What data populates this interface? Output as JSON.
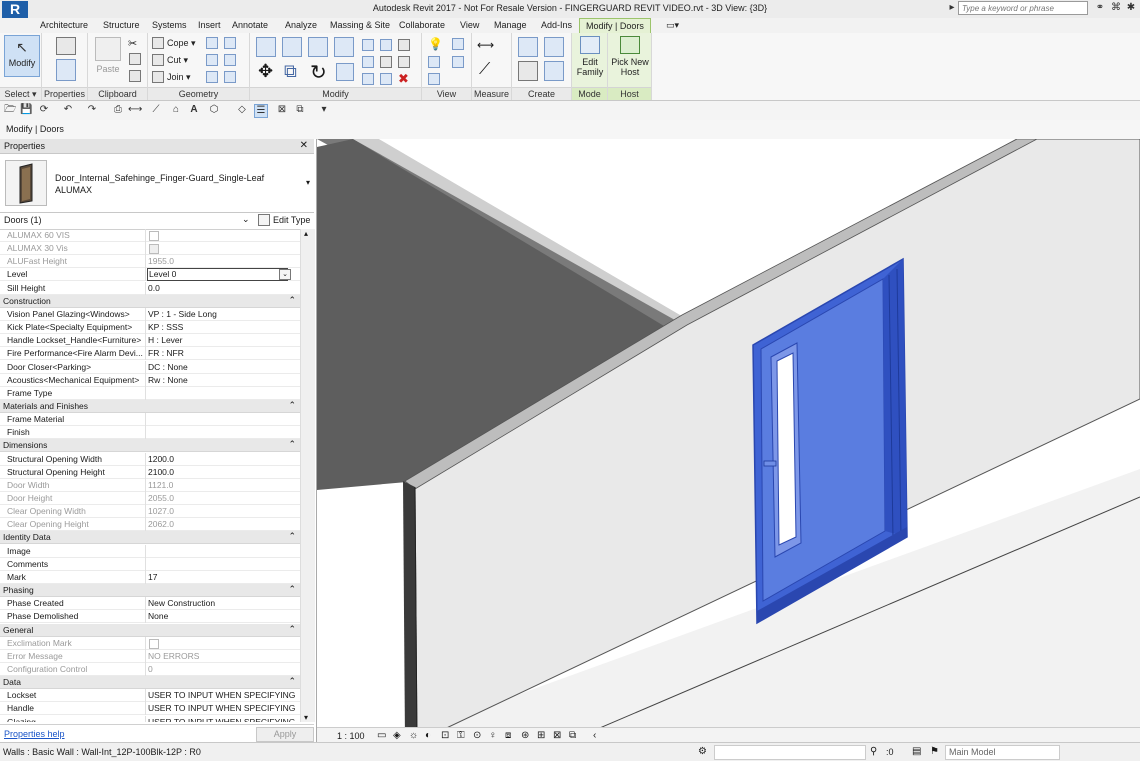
{
  "titlebar": {
    "app_letter": "R",
    "title": "Autodesk Revit 2017 -  Not For Resale Version -    FINGERGUARD REVIT VIDEO.rvt - 3D View: {3D}",
    "search_placeholder": "Type a keyword or phrase"
  },
  "tabs": [
    "Architecture",
    "Structure",
    "Systems",
    "Insert",
    "Annotate",
    "Analyze",
    "Massing & Site",
    "Collaborate",
    "View",
    "Manage",
    "Add-Ins",
    "Modify | Doors"
  ],
  "ribbon": {
    "modify_label": "Modify",
    "select_label": "Select",
    "properties_label": "Properties",
    "clipboard_label": "Clipboard",
    "paste_label": "Paste",
    "cope_label": "Cope",
    "cut_label": "Cut",
    "join_label": "Join",
    "geometry_label": "Geometry",
    "modify_panel_label": "Modify",
    "view_label": "View",
    "measure_label": "Measure",
    "create_label": "Create",
    "edit_family_label": "Edit Family",
    "mode_label": "Mode",
    "pick_new_host_label": "Pick New Host",
    "host_label": "Host"
  },
  "options_bar": {
    "label": "Modify | Doors"
  },
  "properties": {
    "header": "Properties",
    "type_name": "Door_Internal_Safehinge_Finger-Guard_Single-Leaf",
    "type_sub": "ALUMAX",
    "instance_filter": "Doors (1)",
    "edit_type": "Edit Type",
    "help_link": "Properties help",
    "apply": "Apply",
    "rows": [
      {
        "kind": "row",
        "k": "ALUMAX 60 VIS",
        "v": "",
        "chk": "off",
        "dim": true
      },
      {
        "kind": "row",
        "k": "ALUMAX 30 Vis",
        "v": "",
        "chk": "on",
        "dim": true
      },
      {
        "kind": "row",
        "k": "ALUFast Height",
        "v": "1955.0",
        "dim": true
      },
      {
        "kind": "row",
        "k": "Level",
        "v": "Level 0",
        "select": true
      },
      {
        "kind": "row",
        "k": "Sill Height",
        "v": "0.0"
      },
      {
        "kind": "grp",
        "k": "Construction"
      },
      {
        "kind": "row",
        "k": "Vision Panel Glazing<Windows>",
        "v": "VP : 1 - Side Long"
      },
      {
        "kind": "row",
        "k": "Kick Plate<Specialty Equipment>",
        "v": "KP : SSS"
      },
      {
        "kind": "row",
        "k": "Handle Lockset_Handle<Furniture>",
        "v": "H : Lever"
      },
      {
        "kind": "row",
        "k": "Fire Performance<Fire Alarm Devi...",
        "v": "FR : NFR"
      },
      {
        "kind": "row",
        "k": "Door Closer<Parking>",
        "v": "DC : None"
      },
      {
        "kind": "row",
        "k": "Acoustics<Mechanical Equipment>",
        "v": "Rw : None"
      },
      {
        "kind": "row",
        "k": "Frame Type",
        "v": ""
      },
      {
        "kind": "grp",
        "k": "Materials and Finishes"
      },
      {
        "kind": "row",
        "k": "Frame Material",
        "v": ""
      },
      {
        "kind": "row",
        "k": "Finish",
        "v": ""
      },
      {
        "kind": "grp",
        "k": "Dimensions"
      },
      {
        "kind": "row",
        "k": "Structural Opening Width",
        "v": "1200.0"
      },
      {
        "kind": "row",
        "k": "Structural Opening Height",
        "v": "2100.0"
      },
      {
        "kind": "row",
        "k": "Door Width",
        "v": "1121.0",
        "dim": true
      },
      {
        "kind": "row",
        "k": "Door Height",
        "v": "2055.0",
        "dim": true
      },
      {
        "kind": "row",
        "k": "Clear Opening Width",
        "v": "1027.0",
        "dim": true
      },
      {
        "kind": "row",
        "k": "Clear Opening Height",
        "v": "2062.0",
        "dim": true
      },
      {
        "kind": "grp",
        "k": "Identity Data"
      },
      {
        "kind": "row",
        "k": "Image",
        "v": ""
      },
      {
        "kind": "row",
        "k": "Comments",
        "v": ""
      },
      {
        "kind": "row",
        "k": "Mark",
        "v": "17"
      },
      {
        "kind": "grp",
        "k": "Phasing"
      },
      {
        "kind": "row",
        "k": "Phase Created",
        "v": "New Construction"
      },
      {
        "kind": "row",
        "k": "Phase Demolished",
        "v": "None"
      },
      {
        "kind": "grp",
        "k": "General"
      },
      {
        "kind": "row",
        "k": "Exclimation Mark",
        "v": "",
        "chk": "off",
        "dim": true
      },
      {
        "kind": "row",
        "k": "Error Message",
        "v": "NO ERRORS",
        "dim": true
      },
      {
        "kind": "row",
        "k": "Configuration Control",
        "v": "0",
        "dim": true
      },
      {
        "kind": "grp",
        "k": "Data"
      },
      {
        "kind": "row",
        "k": "Lockset",
        "v": "USER TO INPUT WHEN SPECIFYING"
      },
      {
        "kind": "row",
        "k": "Handle",
        "v": "USER TO INPUT WHEN SPECIFYING"
      },
      {
        "kind": "row",
        "k": "Glazing",
        "v": "USER TO INPUT WHEN SPECIFYING"
      }
    ]
  },
  "view_control": {
    "scale": "1 : 100"
  },
  "status": {
    "text": "Walls : Basic Wall : Wall-Int_12P-100Blk-12P : R0",
    "count": ":0",
    "model": "Main Model"
  },
  "colors": {
    "selected_door": "#4a6fd8",
    "ribbon_active": "#e5f1d4"
  }
}
